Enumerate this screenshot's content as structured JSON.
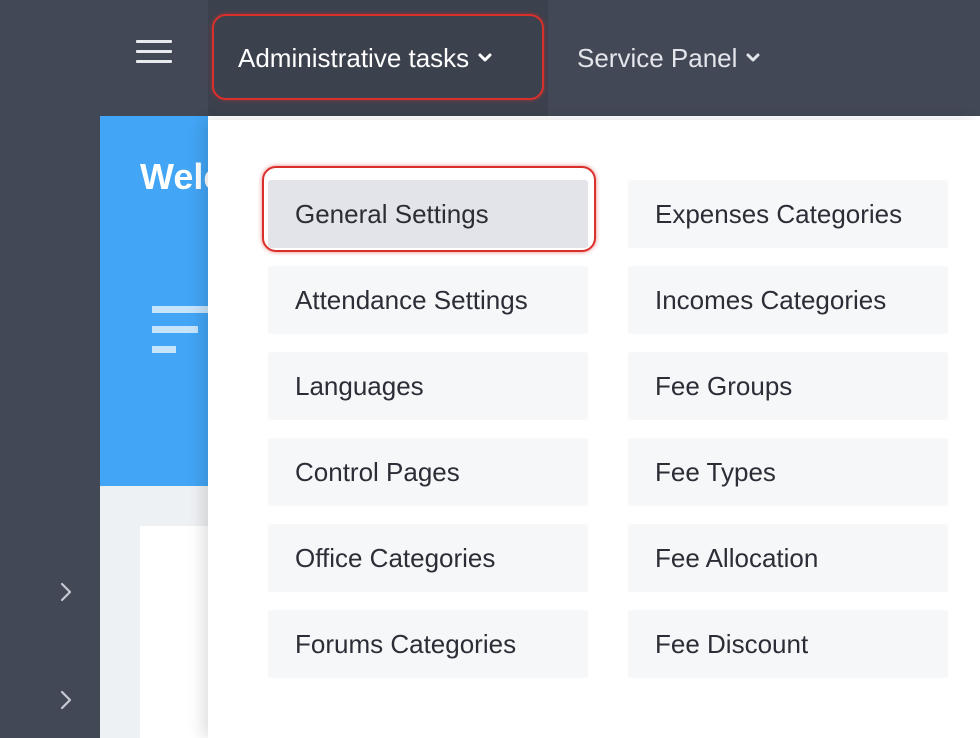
{
  "topbar": {
    "nav": [
      {
        "label": "Administrative tasks"
      },
      {
        "label": "Service Panel"
      }
    ]
  },
  "banner": {
    "welcome_text": "Welc"
  },
  "dropdown": {
    "left_column": [
      {
        "label": "General Settings"
      },
      {
        "label": "Attendance Settings"
      },
      {
        "label": "Languages"
      },
      {
        "label": "Control Pages"
      },
      {
        "label": "Office Categories"
      },
      {
        "label": "Forums Categories"
      }
    ],
    "right_column": [
      {
        "label": "Expenses Categories"
      },
      {
        "label": "Incomes Categories"
      },
      {
        "label": "Fee Groups"
      },
      {
        "label": "Fee Types"
      },
      {
        "label": "Fee Allocation"
      },
      {
        "label": "Fee Discount"
      }
    ]
  },
  "colors": {
    "topbar_bg": "#434857",
    "accent_blue": "#42a5f5",
    "highlight_red": "#d9302c"
  }
}
